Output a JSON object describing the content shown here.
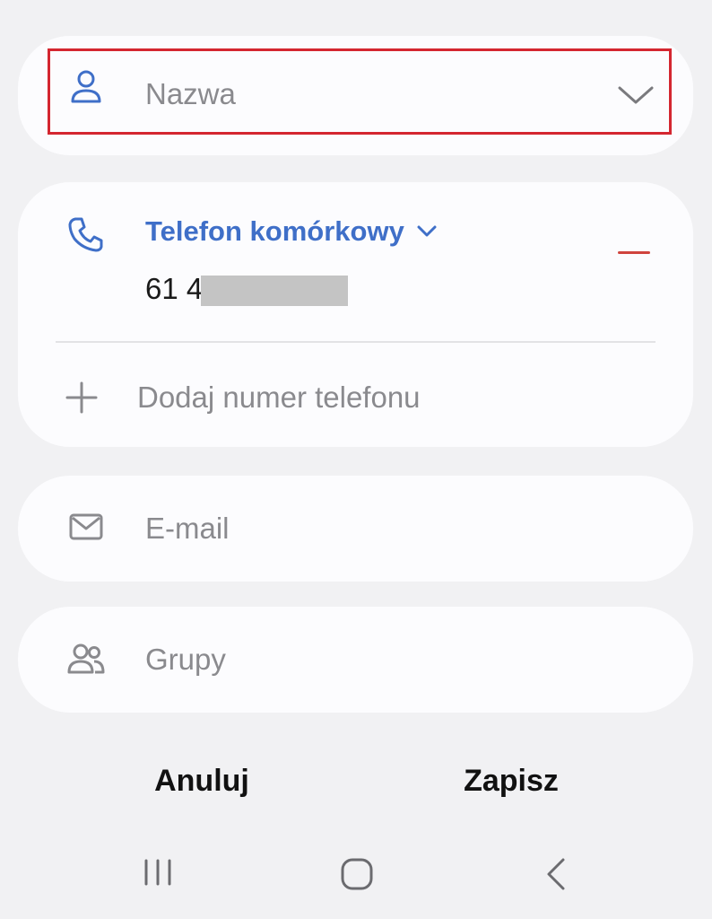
{
  "name_card": {
    "placeholder": "Nazwa",
    "icons": {
      "person": "person-icon",
      "expand": "chevron-down-icon"
    }
  },
  "phone_card": {
    "type_label": "Telefon komórkowy",
    "number_visible": "61 4",
    "add_label": "Dodaj numer telefonu",
    "icons": {
      "phone": "phone-icon",
      "type_dropdown": "chevron-down-icon",
      "remove": "minus-icon",
      "add": "plus-icon"
    }
  },
  "email_card": {
    "placeholder": "E-mail",
    "icon": "envelope-icon"
  },
  "groups_card": {
    "placeholder": "Grupy",
    "icon": "people-icon"
  },
  "actions": {
    "cancel_label": "Anuluj",
    "save_label": "Zapisz"
  },
  "navbar": {
    "items": [
      "recent-apps-icon",
      "home-icon",
      "back-icon"
    ]
  },
  "colors": {
    "accent": "#3f6fc8",
    "remove": "#d0443d",
    "highlight_border": "#d42630",
    "card_background": "#fcfcfe",
    "page_background": "#f1f1f3"
  }
}
